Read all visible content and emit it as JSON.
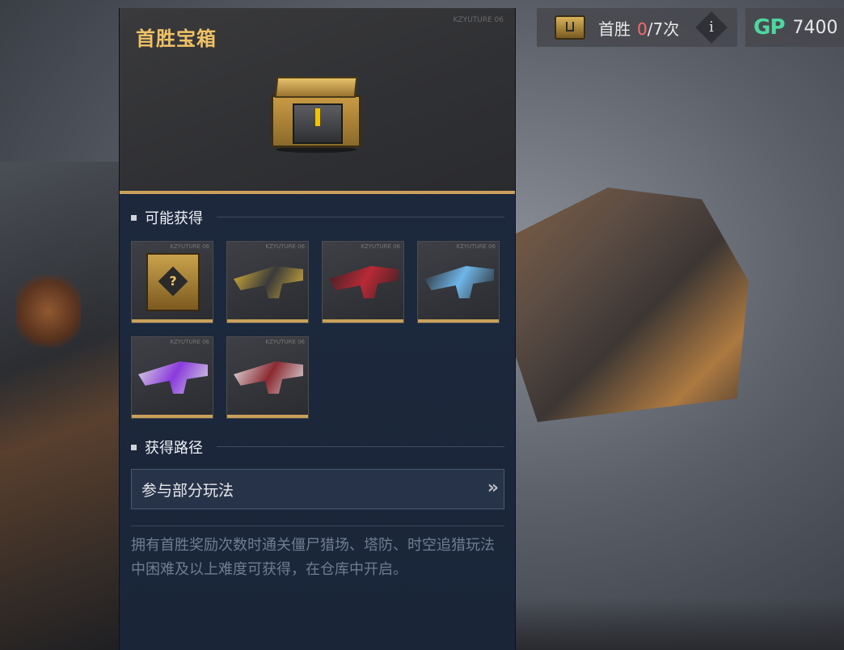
{
  "hud": {
    "first_win_label": "首胜",
    "count_current": "0",
    "count_rest": "/7次",
    "info_icon": "i",
    "gp_icon_text": "GP",
    "gp_value": "7400"
  },
  "panel": {
    "title": "首胜宝箱",
    "watermark": "KZYUTURE 06",
    "possible_section": "可能获得",
    "route_section": "获得路径",
    "route_label": "参与部分玩法",
    "route_arrow": "»",
    "description": "拥有首胜奖励次数时通关僵尸猎场、塔防、时空追猎玩法中困难及以上难度可获得，在仓库中开启。"
  },
  "rewards": [
    {
      "kind": "mystery",
      "colors": [
        "#caa24c",
        "#7c5a20"
      ]
    },
    {
      "kind": "gun",
      "colors": [
        "#3a3a3a",
        "#d8b23a"
      ]
    },
    {
      "kind": "gun",
      "colors": [
        "#b82a36",
        "#3a2024"
      ]
    },
    {
      "kind": "gun",
      "colors": [
        "#6fb6e8",
        "#2a2c30"
      ]
    },
    {
      "kind": "gun",
      "colors": [
        "#8a3adc",
        "#d8d8e0"
      ]
    },
    {
      "kind": "gun",
      "colors": [
        "#8a2a30",
        "#e0e0e4"
      ]
    }
  ],
  "colors": {
    "accent_gold": "#f0c266",
    "count_red": "#ff6a6a",
    "gp_green": "#4fd6a0"
  }
}
